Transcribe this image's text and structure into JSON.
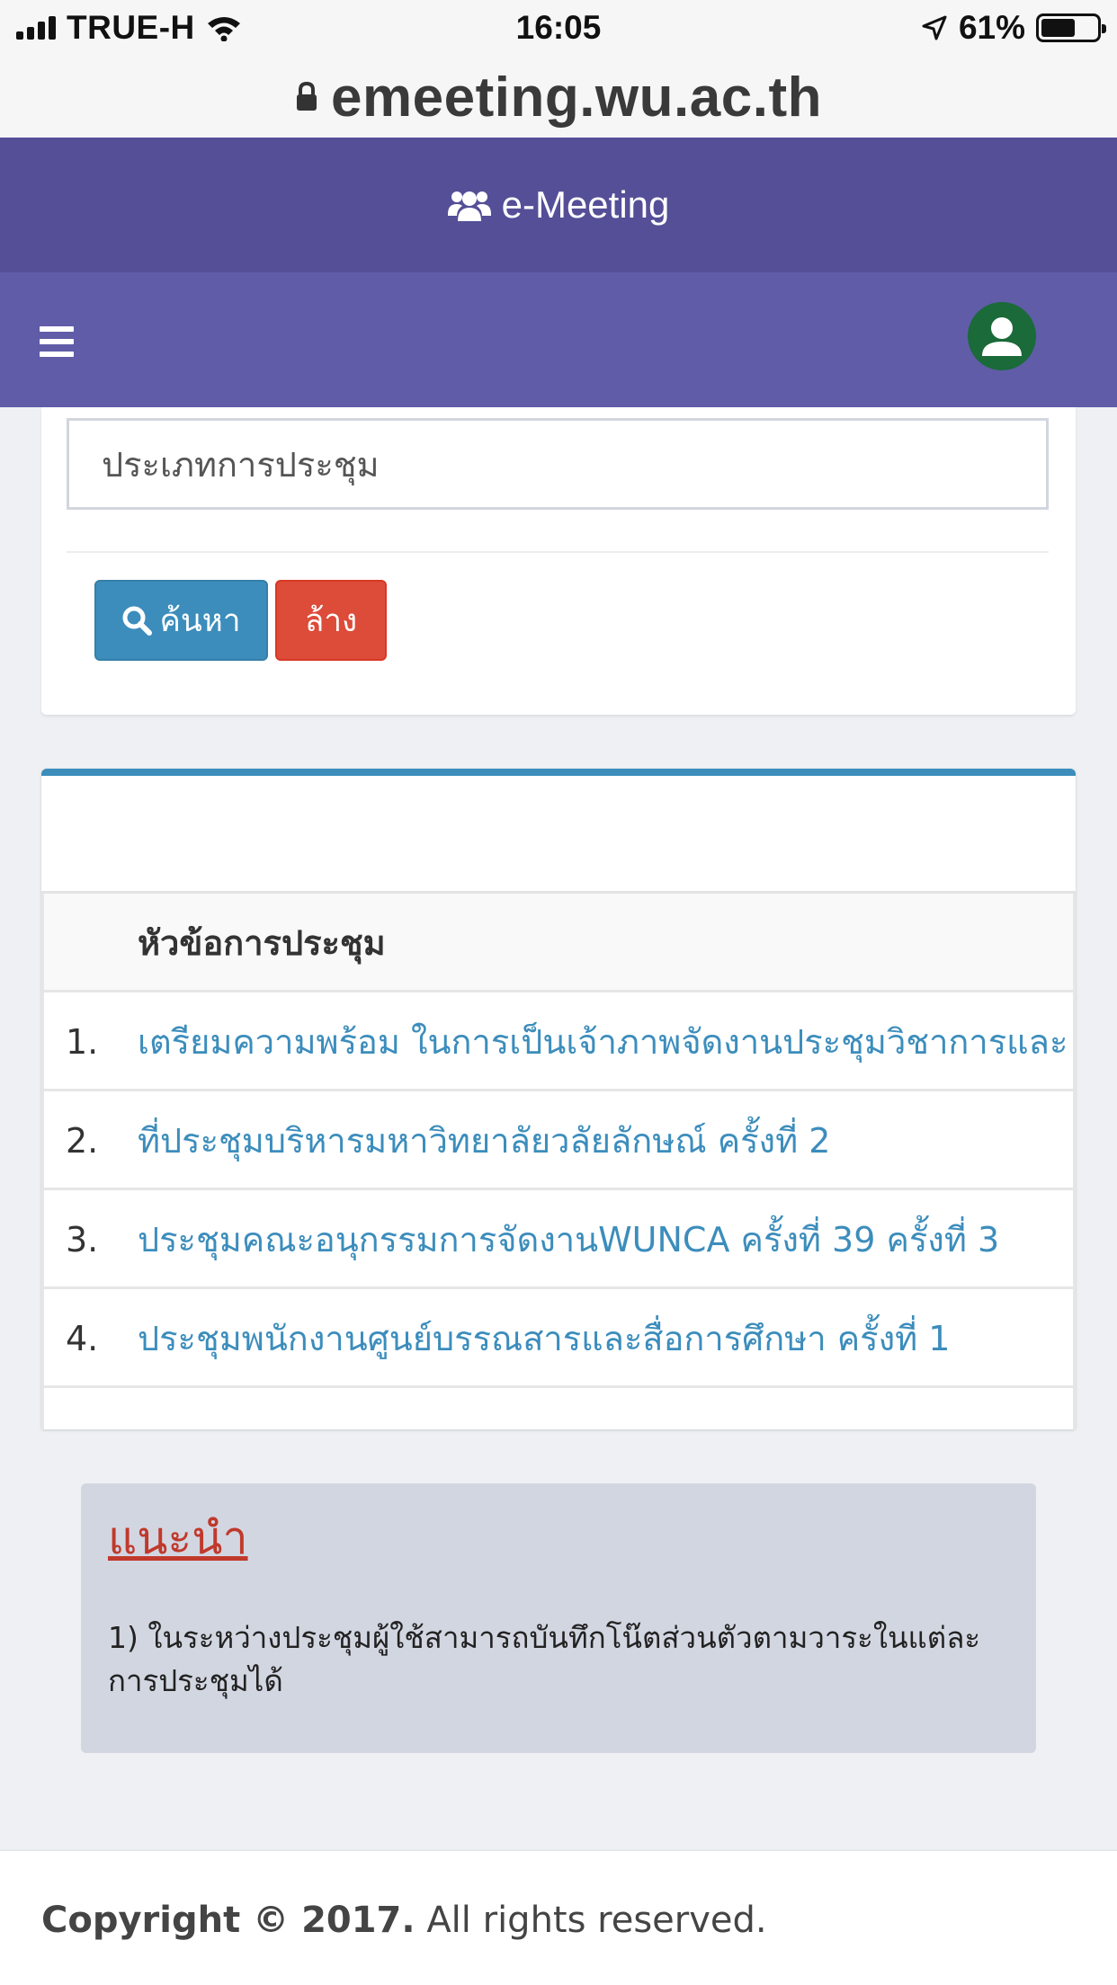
{
  "status_bar": {
    "carrier": "TRUE-H",
    "time": "16:05",
    "battery": "61%",
    "battery_level": 0.61
  },
  "browser": {
    "url": "emeeting.wu.ac.th"
  },
  "app": {
    "brand": "e-Meeting",
    "colors": {
      "brand_bar": "#544f97",
      "nav_bar": "#605ca8",
      "primary": "#3c8dbc",
      "danger": "#dd4b39",
      "avatar": "#1b6a3a"
    }
  },
  "search": {
    "type_placeholder": "ประเภทการประชุม",
    "search_button": "ค้นหา",
    "clear_button": "ล้าง"
  },
  "meetings": {
    "column_header": "หัวข้อการประชุม",
    "rows": [
      {
        "number": "1.",
        "title": "เตรียมความพร้อม ในการเป็นเจ้าภาพจัดงานประชุมวิชาการและ"
      },
      {
        "number": "2.",
        "title": "ที่ประชุมบริหารมหาวิทยาลัยวลัยลักษณ์ ครั้งที่ 2"
      },
      {
        "number": "3.",
        "title": "ประชุมคณะอนุกรรมการจัดงานWUNCA ครั้งที่ 39 ครั้งที่ 3"
      },
      {
        "number": "4.",
        "title": "ประชุมพนักงานศูนย์บรรณสารและสื่อการศึกษา ครั้งที่ 1"
      }
    ]
  },
  "advice": {
    "title": "แนะนำ",
    "text": "1) ในระหว่างประชุมผู้ใช้สามารถบันทึกโน๊ตส่วนตัวตามวาระในแต่ละการประชุมได้"
  },
  "footer": {
    "copyright": "Copyright © 2017.",
    "rights": "All rights reserved."
  }
}
